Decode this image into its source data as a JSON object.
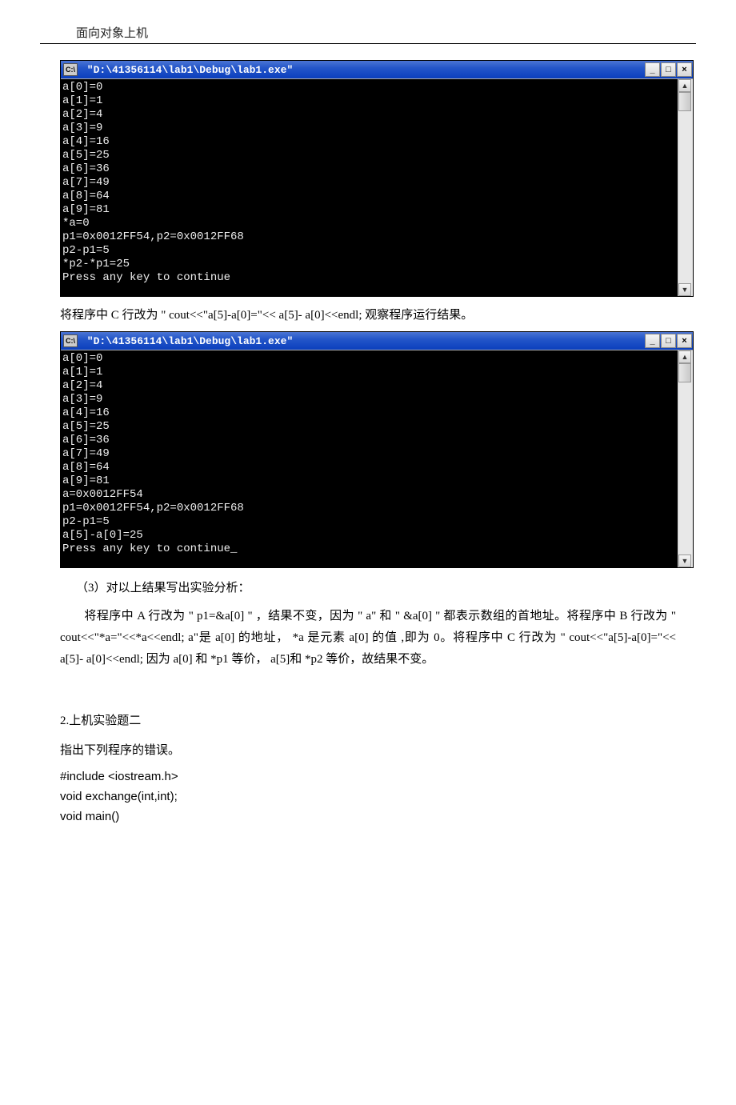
{
  "header": {
    "title": "面向对象上机"
  },
  "console1": {
    "title": " \"D:\\41356114\\lab1\\Debug\\lab1.exe\"",
    "lines": [
      "a[0]=0",
      "a[1]=1",
      "a[2]=4",
      "a[3]=9",
      "a[4]=16",
      "a[5]=25",
      "a[6]=36",
      "a[7]=49",
      "a[8]=64",
      "a[9]=81",
      "*a=0",
      "p1=0x0012FF54,p2=0x0012FF68",
      "p2-p1=5",
      "*p2-*p1=25",
      "Press any key to continue"
    ]
  },
  "text_between": "将程序中  C 行改为  \" cout<<\"a[5]-a[0]=\"<< a[5]- a[0]<<endl;  观察程序运行结果。",
  "console2": {
    "title": " \"D:\\41356114\\lab1\\Debug\\lab1.exe\"",
    "lines": [
      "a[0]=0",
      "a[1]=1",
      "a[2]=4",
      "a[3]=9",
      "a[4]=16",
      "a[5]=25",
      "a[6]=36",
      "a[7]=49",
      "a[8]=64",
      "a[9]=81",
      "a=0x0012FF54",
      "p1=0x0012FF54,p2=0x0012FF68",
      "p2-p1=5",
      "a[5]-a[0]=25",
      "Press any key to continue_"
    ]
  },
  "analysis": {
    "heading": "（3）对以上结果写出实验分析：",
    "para": "将程序中  A 行改为 \" p1=&a[0] \" ，结果不变，因为 \"  a\" 和 \" &a[0] \" 都表示数组的首地址。将程序中  B 行改为 \" cout<<\"*a=\"<<*a<<endl;  a\"是 a[0] 的地址，  *a 是元素  a[0] 的值 ,即为 0。将程序中  C 行改为  \" cout<<\"a[5]-a[0]=\"<< a[5]- a[0]<<endl;  因为 a[0] 和 *p1 等价，  a[5]和 *p2 等价，故结果不变。"
  },
  "section2": {
    "title": "2.上机实验题二",
    "instruction": "指出下列程序的错误。",
    "code": [
      "#include <iostream.h>",
      "void exchange(int,int);",
      "void main()"
    ]
  },
  "win_controls": {
    "minimize": "_",
    "maximize": "□",
    "close": "×",
    "up": "▲",
    "down": "▼",
    "icon_label": "C:\\"
  }
}
